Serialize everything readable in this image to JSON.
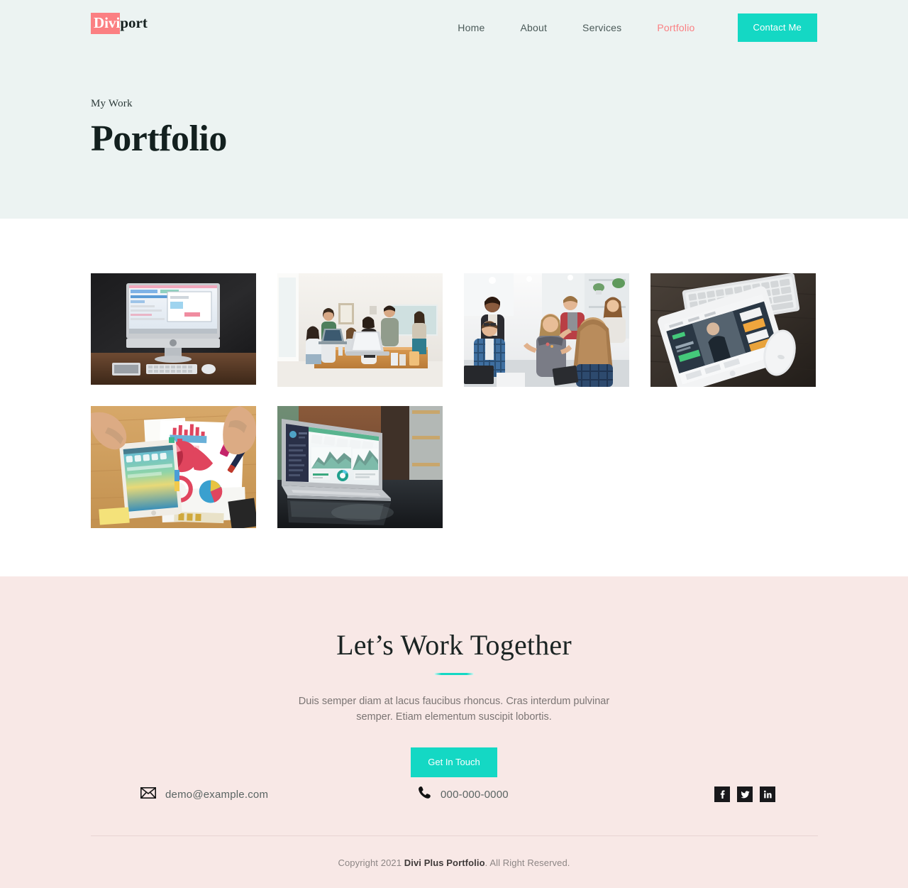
{
  "header": {
    "logo": {
      "mark": "Divi",
      "rest": "port",
      "mark_bg": "#fb7f82"
    },
    "nav": [
      {
        "label": "Home",
        "active": false
      },
      {
        "label": "About",
        "active": false
      },
      {
        "label": "Services",
        "active": false
      },
      {
        "label": "Portfolio",
        "active": true
      }
    ],
    "cta_button": {
      "label": "Contact Me",
      "color": "#14d8c4"
    }
  },
  "hero": {
    "eyebrow": "My Work",
    "title": "Portfolio",
    "background": "#ecf3f2"
  },
  "portfolio": {
    "items": [
      {
        "alt": "imac-desktop-on-desk",
        "scene": "imac"
      },
      {
        "alt": "team-meeting-bright-room",
        "scene": "team-bright"
      },
      {
        "alt": "office-group-discussion",
        "scene": "office-group"
      },
      {
        "alt": "tablet-keyboard-mouse",
        "scene": "tablet-desk"
      },
      {
        "alt": "hands-tablet-charts-desk",
        "scene": "charts-desk"
      },
      {
        "alt": "laptop-analytics-dashboard",
        "scene": "laptop-dash"
      }
    ]
  },
  "cta": {
    "title": "Let’s Work Together",
    "text": "Duis semper diam at lacus faucibus rhoncus. Cras interdum pulvinar semper. Etiam elementum suscipit lobortis.",
    "button": {
      "label": "Get In Touch",
      "color": "#14d8c4"
    },
    "background": "#f8e8e6"
  },
  "contact": {
    "email": {
      "icon": "envelope-icon",
      "value": "demo@example.com"
    },
    "phone": {
      "icon": "phone-icon",
      "value": "000-000-0000"
    },
    "social": [
      {
        "icon": "facebook-icon",
        "label": "f"
      },
      {
        "icon": "twitter-icon",
        "label": "t"
      },
      {
        "icon": "linkedin-icon",
        "label": "in"
      }
    ]
  },
  "footer": {
    "copyright_prefix": "Copyright 2021 ",
    "copyright_brand": "Divi Plus Portfolio",
    "copyright_suffix": ". All Right Reserved."
  }
}
